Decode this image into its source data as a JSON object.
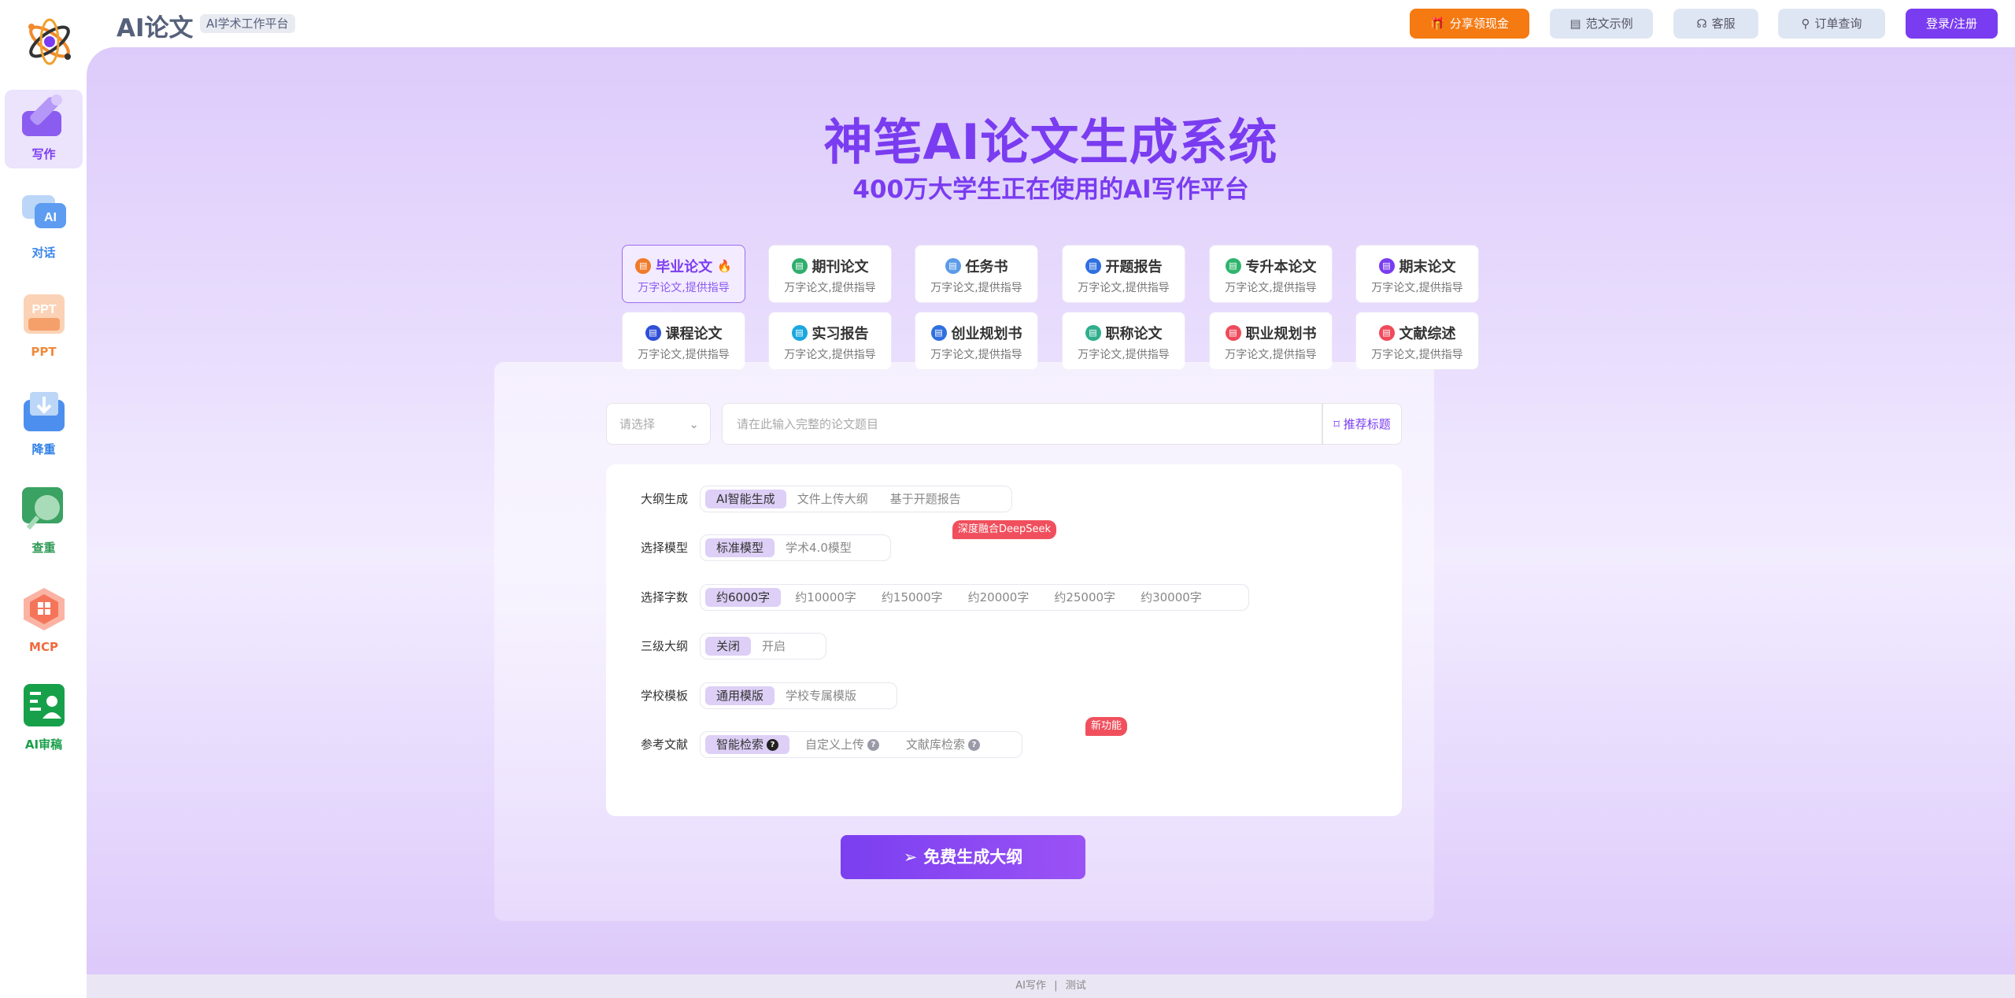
{
  "brand": {
    "name": "AI论文",
    "badge": "AI学术工作平台"
  },
  "topbar": {
    "share": "分享领现金",
    "examples": "范文示例",
    "service": "客服",
    "orders": "订单查询",
    "login": "登录/注册"
  },
  "sidebar": {
    "items": [
      {
        "label": "写作",
        "color": "#7a3cf0"
      },
      {
        "label": "对话",
        "color": "#3a86e8"
      },
      {
        "label": "PPT",
        "color": "#f08a3c"
      },
      {
        "label": "降重",
        "color": "#2f7fe6"
      },
      {
        "label": "查重",
        "color": "#2f9a56"
      },
      {
        "label": "MCP",
        "color": "#f06a3c"
      },
      {
        "label": "AI审稿",
        "color": "#1aa04a"
      }
    ]
  },
  "hero": {
    "title": "神笔AI论文生成系统",
    "subtitle": "400万大学生正在使用的AI写作平台"
  },
  "types": [
    {
      "title": "毕业论文",
      "sub": "万字论文,提供指导",
      "color": "#f07a28",
      "hot": "🔥"
    },
    {
      "title": "期刊论文",
      "sub": "万字论文,提供指导",
      "color": "#2fae6c"
    },
    {
      "title": "任务书",
      "sub": "万字论文,提供指导",
      "color": "#5b9be8"
    },
    {
      "title": "开题报告",
      "sub": "万字论文,提供指导",
      "color": "#2f6fe0"
    },
    {
      "title": "专升本论文",
      "sub": "万字论文,提供指导",
      "color": "#2fb46e"
    },
    {
      "title": "期末论文",
      "sub": "万字论文,提供指导",
      "color": "#7a3cf0"
    },
    {
      "title": "课程论文",
      "sub": "万字论文,提供指导",
      "color": "#2f4fd8"
    },
    {
      "title": "实习报告",
      "sub": "万字论文,提供指导",
      "color": "#1aa7e0"
    },
    {
      "title": "创业规划书",
      "sub": "万字论文,提供指导",
      "color": "#2f6fe0"
    },
    {
      "title": "职称论文",
      "sub": "万字论文,提供指导",
      "color": "#2fae8c"
    },
    {
      "title": "职业规划书",
      "sub": "万字论文,提供指导",
      "color": "#f04a5a"
    },
    {
      "title": "文献综述",
      "sub": "万字论文,提供指导",
      "color": "#f04a5a"
    }
  ],
  "form": {
    "select_placeholder": "请选择",
    "title_placeholder": "请在此输入完整的论文题目",
    "recommend": "推荐标题"
  },
  "options": {
    "outline": {
      "label": "大纲生成",
      "opts": [
        "AI智能生成",
        "文件上传大纲",
        "基于开题报告"
      ],
      "selected": 0
    },
    "model": {
      "label": "选择模型",
      "opts": [
        "标准模型",
        "学术4.0模型"
      ],
      "selected": 0,
      "tag": "深度融合DeepSeek"
    },
    "words": {
      "label": "选择字数",
      "opts": [
        "约6000字",
        "约10000字",
        "约15000字",
        "约20000字",
        "约25000字",
        "约30000字"
      ],
      "selected": 0
    },
    "third": {
      "label": "三级大纲",
      "opts": [
        "关闭",
        "开启"
      ],
      "selected": 0
    },
    "template": {
      "label": "学校模板",
      "opts": [
        "通用模版",
        "学校专属模版"
      ],
      "selected": 0
    },
    "refs": {
      "label": "参考文献",
      "opts": [
        "智能检索",
        "自定义上传",
        "文献库检索"
      ],
      "selected": 0,
      "tag": "新功能"
    }
  },
  "cta": "免费生成大纲",
  "footer": {
    "left": "AI写作",
    "sep": "|",
    "right": "测试"
  }
}
